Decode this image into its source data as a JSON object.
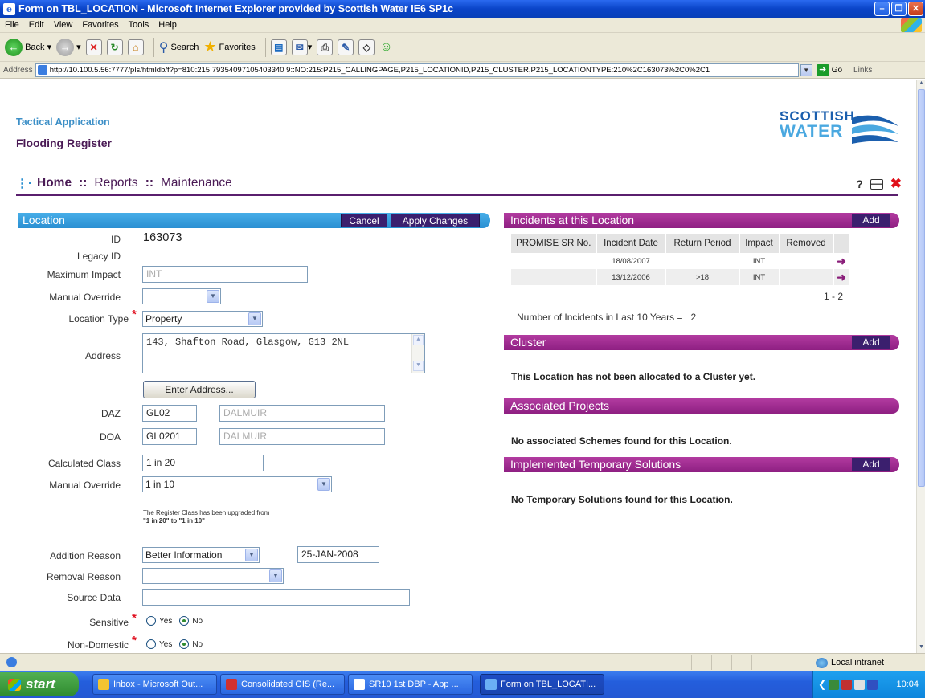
{
  "window": {
    "title": "Form on TBL_LOCATION - Microsoft Internet Explorer provided by Scottish Water IE6 SP1c"
  },
  "menu": [
    "File",
    "Edit",
    "View",
    "Favorites",
    "Tools",
    "Help"
  ],
  "toolbar": {
    "back": "Back",
    "search": "Search",
    "favorites": "Favorites"
  },
  "address": {
    "label": "Address",
    "url": "http://10.100.5.56:7777/pls/htmldb/f?p=810:215:79354097105403340 9::NO:215:P215_CALLINGPAGE,P215_LOCATIONID,P215_CLUSTER,P215_LOCATIONTYPE:210%2C163073%2C0%2C1",
    "go": "Go",
    "links": "Links"
  },
  "app": {
    "tactical": "Tactical Application",
    "register": "Flooding Register",
    "logo_line1": "SCOTTISH",
    "logo_line2": "WATER"
  },
  "nav": {
    "home": "Home",
    "reports": "Reports",
    "maintenance": "Maintenance",
    "help": "?"
  },
  "location": {
    "header": "Location",
    "cancel": "Cancel",
    "apply": "Apply Changes",
    "id_label": "ID",
    "id_value": "163073",
    "legacy_label": "Legacy ID",
    "max_impact_label": "Maximum Impact",
    "max_impact_value": "INT",
    "manual_override_label": "Manual Override",
    "location_type_label": "Location Type",
    "location_type_value": "Property",
    "address_label": "Address",
    "address_value": "143, Shafton Road, Glasgow, G13 2NL",
    "enter_address": "Enter Address...",
    "daz_label": "DAZ",
    "daz_code": "GL02",
    "daz_name": "DALMUIR",
    "doa_label": "DOA",
    "doa_code": "GL0201",
    "doa_name": "DALMUIR",
    "calc_class_label": "Calculated Class",
    "calc_class_value": "1 in 20",
    "manual_override2_label": "Manual Override",
    "manual_override2_value": "1 in 10",
    "note_line1": "The Register Class has been upgraded from",
    "note_line2": "\"1 in 20\" to \"1 in 10\"",
    "addition_reason_label": "Addition Reason",
    "addition_reason_value": "Better Information",
    "addition_date": "25-JAN-2008",
    "removal_reason_label": "Removal Reason",
    "source_data_label": "Source Data",
    "sensitive_label": "Sensitive",
    "nondomestic_label": "Non-Domestic",
    "yes": "Yes",
    "no": "No"
  },
  "incidents": {
    "header": "Incidents at this Location",
    "add": "Add",
    "columns": [
      "PROMISE SR No.",
      "Incident Date",
      "Return Period",
      "Impact",
      "Removed"
    ],
    "rows": [
      {
        "sr": "",
        "date": "18/08/2007",
        "period": "",
        "impact": "INT",
        "removed": ""
      },
      {
        "sr": "",
        "date": "13/12/2006",
        "period": ">18",
        "impact": "INT",
        "removed": ""
      }
    ],
    "pager": "1 - 2",
    "count_label": "Number of Incidents in Last 10 Years =",
    "count_value": "2"
  },
  "cluster": {
    "header": "Cluster",
    "add": "Add",
    "message": "This Location has not been allocated to a Cluster yet."
  },
  "projects": {
    "header": "Associated Projects",
    "message": "No associated Schemes found for this Location."
  },
  "temp": {
    "header": "Implemented Temporary Solutions",
    "add": "Add",
    "message": "No Temporary Solutions found for this Location."
  },
  "status": {
    "zone": "Local intranet"
  },
  "taskbar": {
    "start": "start",
    "tasks": [
      "Inbox - Microsoft Out...",
      "Consolidated GIS (Re...",
      "SR10 1st DBP - App ...",
      "Form on TBL_LOCATI..."
    ],
    "clock": "10:04"
  },
  "colors": {
    "accent_blue": "#2a8fd2",
    "accent_purple": "#8e1f82",
    "nav_purple": "#4a1a55",
    "button": "#3b1f6e",
    "required": "#e01020"
  }
}
